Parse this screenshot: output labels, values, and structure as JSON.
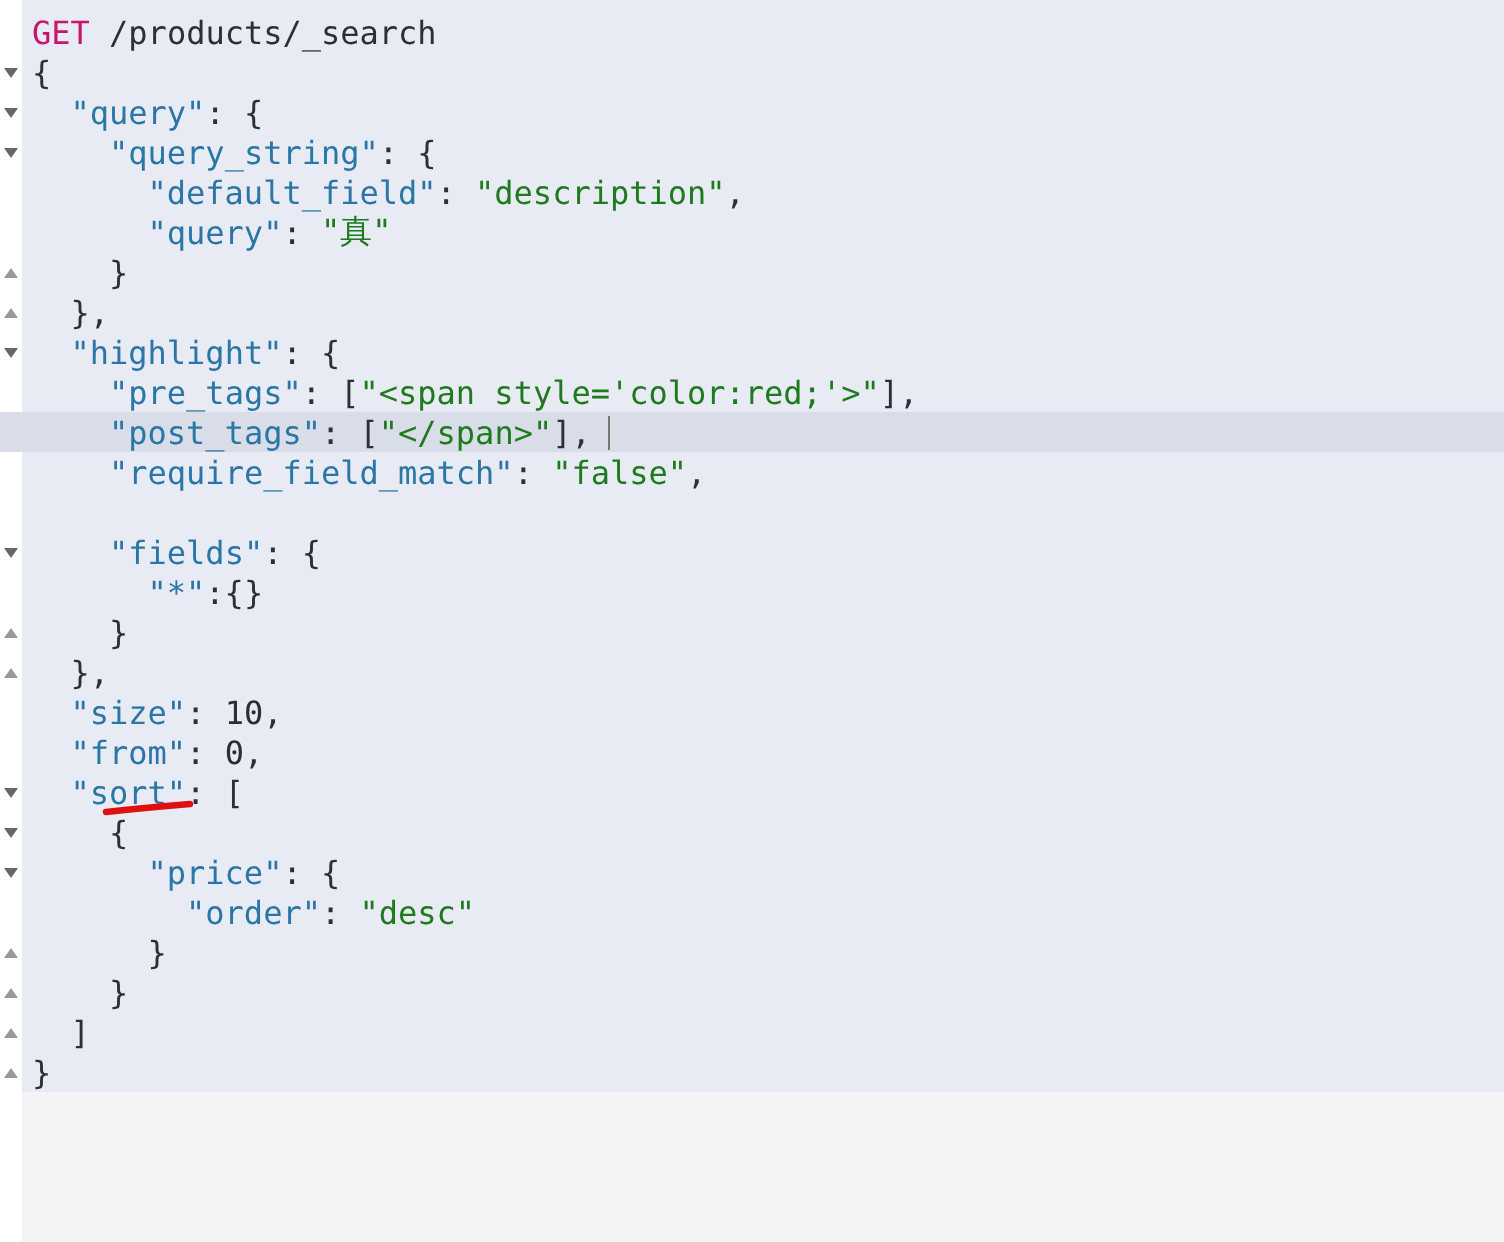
{
  "editor": {
    "lines": [
      {
        "kind": "plain",
        "tokens": [
          {
            "text": "GET",
            "kind": "method"
          },
          {
            "text": " /products/_search",
            "kind": "path"
          }
        ]
      },
      {
        "kind": "block-open",
        "tokens": [
          {
            "text": "{",
            "kind": "punct"
          }
        ],
        "children": [
          {
            "kind": "block-open",
            "tokens": [
              {
                "text": "\"query\"",
                "kind": "key"
              },
              {
                "text": ": {",
                "kind": "punct"
              }
            ],
            "children": [
              {
                "kind": "block-open",
                "tokens": [
                  {
                    "text": "\"query_string\"",
                    "kind": "key"
                  },
                  {
                    "text": ": {",
                    "kind": "punct"
                  }
                ],
                "children": [
                  {
                    "kind": "plain",
                    "tokens": [
                      {
                        "text": "\"default_field\"",
                        "kind": "key"
                      },
                      {
                        "text": ": ",
                        "kind": "punct"
                      },
                      {
                        "text": "\"description\"",
                        "kind": "string"
                      },
                      {
                        "text": ",",
                        "kind": "punct"
                      }
                    ]
                  },
                  {
                    "kind": "plain",
                    "tokens": [
                      {
                        "text": "\"query\"",
                        "kind": "key"
                      },
                      {
                        "text": ": ",
                        "kind": "punct"
                      },
                      {
                        "text": "\"真\"",
                        "kind": "string"
                      }
                    ]
                  }
                ]
              },
              {
                "kind": "block-close",
                "tokens": [
                  {
                    "text": "}",
                    "kind": "punct"
                  }
                ]
              }
            ]
          },
          {
            "kind": "block-close",
            "tokens": [
              {
                "text": "},",
                "kind": "punct"
              }
            ]
          },
          {
            "kind": "block-open",
            "tokens": [
              {
                "text": "\"highlight\"",
                "kind": "key"
              },
              {
                "text": ": {",
                "kind": "punct"
              }
            ],
            "children": [
              {
                "kind": "plain",
                "tokens": [
                  {
                    "text": "\"pre_tags\"",
                    "kind": "key"
                  },
                  {
                    "text": ": [",
                    "kind": "punct"
                  },
                  {
                    "text": "\"<span style='color:red;'>\"",
                    "kind": "string"
                  },
                  {
                    "text": "],",
                    "kind": "punct"
                  }
                ]
              },
              {
                "kind": "plain",
                "active": true,
                "tokens": [
                  {
                    "text": "\"post_tags\"",
                    "kind": "key"
                  },
                  {
                    "text": ": [",
                    "kind": "punct"
                  },
                  {
                    "text": "\"</span>\"",
                    "kind": "string"
                  },
                  {
                    "text": "],",
                    "kind": "punct"
                  }
                ]
              },
              {
                "kind": "plain",
                "tokens": [
                  {
                    "text": "\"require_field_match\"",
                    "kind": "key"
                  },
                  {
                    "text": ": ",
                    "kind": "punct"
                  },
                  {
                    "text": "\"false\"",
                    "kind": "string"
                  },
                  {
                    "text": ",",
                    "kind": "punct"
                  }
                ]
              },
              {
                "kind": "plain"
              },
              {
                "kind": "block-open",
                "tokens": [
                  {
                    "text": "\"fields\"",
                    "kind": "key"
                  },
                  {
                    "text": ": {",
                    "kind": "punct"
                  }
                ],
                "children": [
                  {
                    "kind": "plain",
                    "tokens": [
                      {
                        "text": "\"*\"",
                        "kind": "key"
                      },
                      {
                        "text": ":{}",
                        "kind": "punct"
                      }
                    ]
                  }
                ]
              },
              {
                "kind": "block-close",
                "tokens": [
                  {
                    "text": "}",
                    "kind": "punct"
                  }
                ]
              }
            ]
          },
          {
            "kind": "block-close",
            "tokens": [
              {
                "text": "},",
                "kind": "punct"
              }
            ]
          },
          {
            "kind": "plain",
            "tokens": [
              {
                "text": "\"size\"",
                "kind": "key"
              },
              {
                "text": ": ",
                "kind": "punct"
              },
              {
                "text": "10",
                "kind": "number"
              },
              {
                "text": ",",
                "kind": "punct"
              }
            ]
          },
          {
            "kind": "plain",
            "tokens": [
              {
                "text": "\"from\"",
                "kind": "key"
              },
              {
                "text": ": ",
                "kind": "punct"
              },
              {
                "text": "0",
                "kind": "number"
              },
              {
                "text": ",",
                "kind": "punct"
              }
            ]
          },
          {
            "kind": "block-open",
            "underlined": true,
            "tokens": [
              {
                "text": "\"sort\"",
                "kind": "key"
              },
              {
                "text": ": [",
                "kind": "punct"
              }
            ],
            "children": [
              {
                "kind": "block-open",
                "tokens": [
                  {
                    "text": "{",
                    "kind": "punct"
                  }
                ],
                "children": [
                  {
                    "kind": "block-open",
                    "tokens": [
                      {
                        "text": "\"price\"",
                        "kind": "key"
                      },
                      {
                        "text": ": {",
                        "kind": "punct"
                      }
                    ],
                    "children": [
                      {
                        "kind": "plain",
                        "tokens": [
                          {
                            "text": "\"order\"",
                            "kind": "key"
                          },
                          {
                            "text": ": ",
                            "kind": "punct"
                          },
                          {
                            "text": "\"desc\"",
                            "kind": "string"
                          }
                        ]
                      }
                    ]
                  },
                  {
                    "kind": "block-close",
                    "tokens": [
                      {
                        "text": "}",
                        "kind": "punct"
                      }
                    ]
                  }
                ]
              },
              {
                "kind": "block-close",
                "tokens": [
                  {
                    "text": "}",
                    "kind": "punct"
                  }
                ]
              }
            ]
          },
          {
            "kind": "block-close",
            "tokens": [
              {
                "text": "]",
                "kind": "punct"
              }
            ]
          }
        ]
      },
      {
        "kind": "block-close",
        "tokens": [
          {
            "text": "}",
            "kind": "punct"
          }
        ]
      }
    ]
  }
}
